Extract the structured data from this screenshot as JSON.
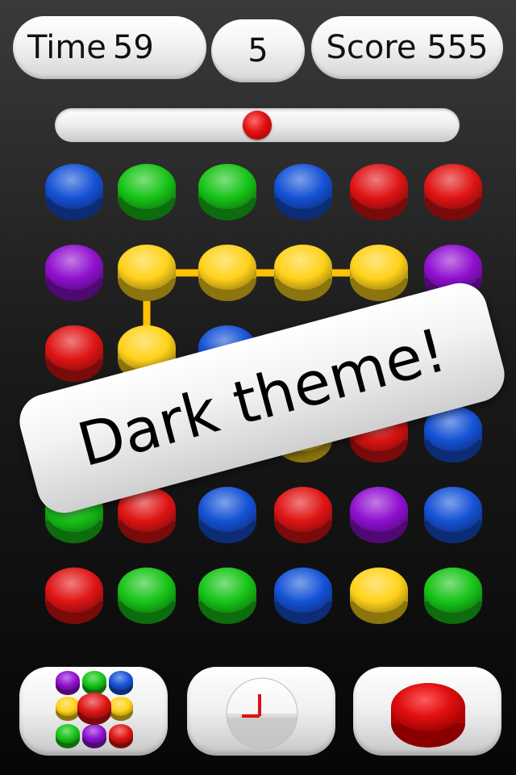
{
  "hud": {
    "time_label": "Time",
    "time_value": "59",
    "level_value": "5",
    "score_label": "Score",
    "score_value": "555"
  },
  "slider": {
    "value_fraction": 0.5
  },
  "board": {
    "rows": [
      [
        "blue",
        "green",
        "green",
        "blue",
        "red",
        "red"
      ],
      [
        "purple",
        "yellow",
        "yellow",
        "yellow",
        "yellow",
        "purple"
      ],
      [
        "red",
        "yellow",
        "blue",
        "",
        "",
        ""
      ],
      [
        "",
        "",
        "yellow",
        "yellow",
        "red",
        "blue"
      ],
      [
        "green",
        "red",
        "blue",
        "red",
        "purple",
        "blue"
      ],
      [
        "red",
        "green",
        "green",
        "blue",
        "yellow",
        "green"
      ]
    ],
    "selected_path": [
      [
        1,
        3
      ],
      [
        1,
        4
      ],
      [
        1,
        2
      ],
      [
        1,
        1
      ],
      [
        2,
        1
      ]
    ]
  },
  "colors": {
    "blue": "#1552d6",
    "green": "#17c417",
    "red": "#e01414",
    "yellow": "#ffd21a",
    "purple": "#9010d0",
    "path_line": "#ffc200"
  },
  "banner": {
    "text": "Dark theme!"
  },
  "bottom_buttons": {
    "themes_icon": "dots-grid-icon",
    "timer_icon": "clock-icon",
    "record_icon": "red-disc-icon"
  }
}
